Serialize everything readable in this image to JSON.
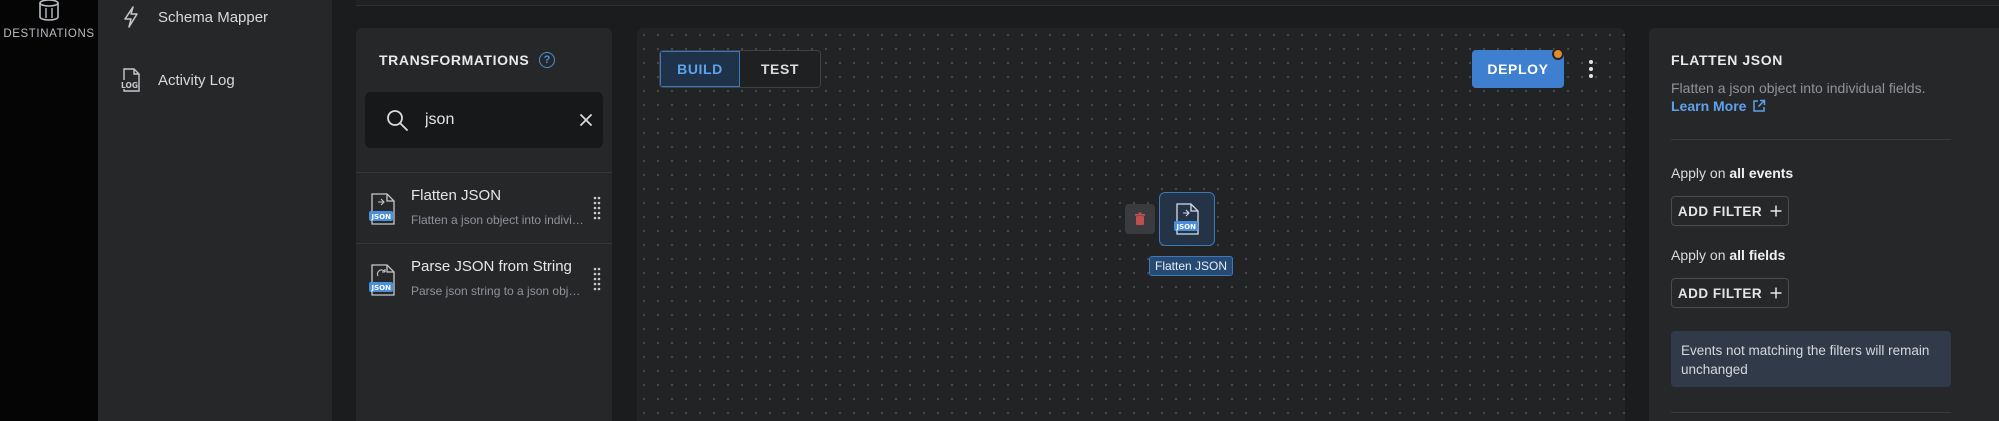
{
  "rail": {
    "destinations_label": "DESTINATIONS"
  },
  "nav": {
    "items": [
      {
        "label": "Schema Mapper",
        "icon": "bolt-icon"
      },
      {
        "label": "Activity Log",
        "icon": "log-file-icon"
      }
    ]
  },
  "transformations": {
    "title": "TRANSFORMATIONS",
    "search": {
      "value": "json"
    },
    "items": [
      {
        "name": "Flatten JSON",
        "description": "Flatten a json object into individual fields.",
        "icon": "json-file-icon"
      },
      {
        "name": "Parse JSON from String",
        "description": "Parse json string to a json object.",
        "icon": "json-file-icon"
      }
    ]
  },
  "canvas": {
    "tabs": [
      {
        "label": "BUILD",
        "active": true
      },
      {
        "label": "TEST",
        "active": false
      }
    ],
    "deploy_label": "DEPLOY",
    "node": {
      "label": "Flatten JSON"
    }
  },
  "details": {
    "title": "FLATTEN JSON",
    "description": "Flatten a json object into individual fields.",
    "learn_more": "Learn More",
    "events_prefix": "Apply on ",
    "events_scope": "all events",
    "fields_prefix": "Apply on ",
    "fields_scope": "all fields",
    "add_filter_label": "ADD FILTER",
    "note": "Events not matching the filters will remain unchanged"
  },
  "colors": {
    "accent": "#3e7fd0",
    "accent_text": "#5fa2ec",
    "deploy_badge": "#e58a2e",
    "delete_icon": "#c0504d"
  }
}
